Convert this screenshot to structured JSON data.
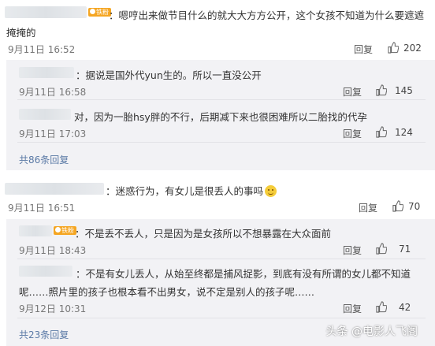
{
  "labels": {
    "reply": "回复",
    "fan_badge": "铁粉"
  },
  "comments": [
    {
      "text_line1": "：嗯哼出来做节目什么的就大大方方公开，这个女孩不知道为什么要遮遮",
      "text_line2": "掩掩的",
      "time": "9月11日 16:52",
      "likes": "202",
      "replies": [
        {
          "text": "：据说是国外代yun生的。所以一直没公开",
          "time": "9月11日 16:58",
          "likes": "145"
        },
        {
          "text": "对，因为一胎hsy胖的不行，后期减下来也很困难所以二胎找的代孕",
          "time": "9月11日 17:03",
          "likes": "124"
        }
      ],
      "more": "共86条回复"
    },
    {
      "text": "：迷惑行为，有女儿是很丢人的事吗",
      "time": "9月11日 16:51",
      "likes": "70",
      "replies": [
        {
          "text": "：不是丢不丢人，只是因为是女孩所以不想暴露在大众面前",
          "time": "9月11日 18:43",
          "likes": "71"
        },
        {
          "text_line1": "：不是有女儿丢人，从始至终都是捕风捉影，到底有没有所谓的女儿都不知道",
          "text_line2": "呢……照片里的孩子也根本看不出男女，说不定是别人的孩子呢……",
          "time": "9月12日 10:31",
          "likes": "42"
        }
      ],
      "more": "共23条回复"
    }
  ],
  "watermark": "头条 @电影人飞阁"
}
